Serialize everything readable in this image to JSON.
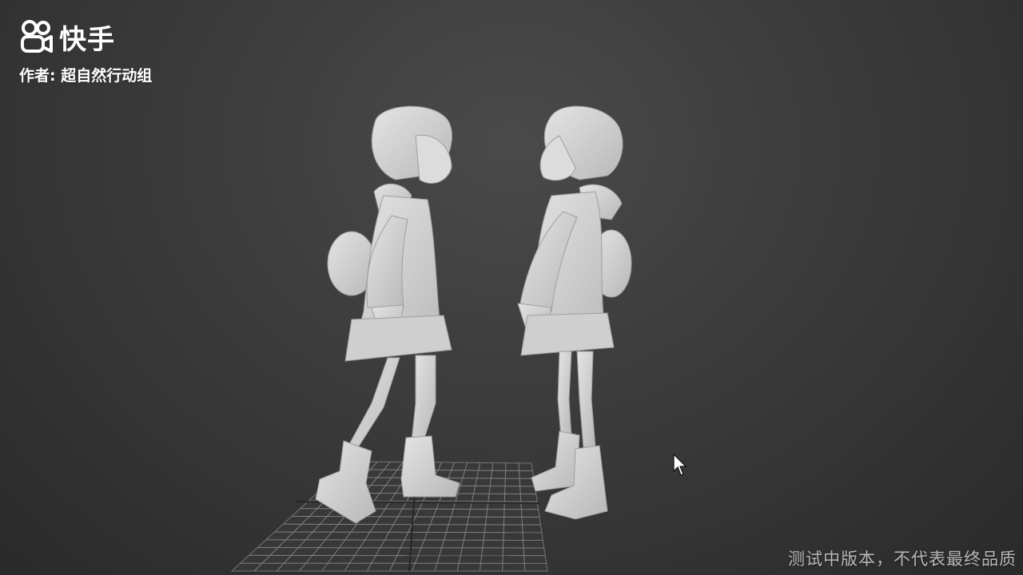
{
  "watermark": {
    "brand_name": "快手",
    "author_label": "作者: 超自然行动组",
    "logo_icon": "kuaishou-logo-icon"
  },
  "scene": {
    "background_color": "#3b3b3b",
    "model_color": "#d6d6d6",
    "grid_color": "#9a9a9a"
  },
  "footer": {
    "disclaimer": "测试中版本，不代表最终品质"
  }
}
